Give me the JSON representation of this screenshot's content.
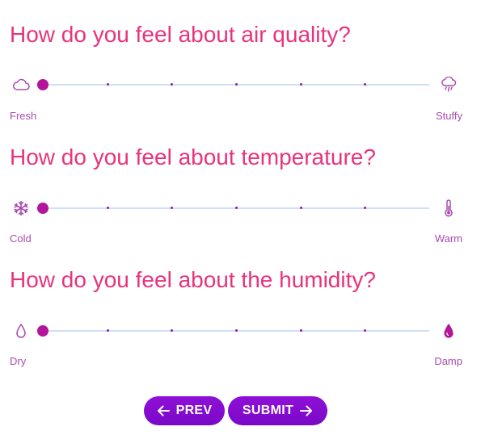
{
  "questions": [
    {
      "title": "How do you feel about air quality?",
      "left_label": "Fresh",
      "right_label": "Stuffy",
      "left_icon": "cloud-icon",
      "right_icon": "cloud-rain-icon",
      "value": 0,
      "steps": 7
    },
    {
      "title": "How do you feel about temperature?",
      "left_label": "Cold",
      "right_label": "Warm",
      "left_icon": "snowflake-icon",
      "right_icon": "thermometer-icon",
      "value": 0,
      "steps": 7
    },
    {
      "title": "How do you feel about the humidity?",
      "left_label": "Dry",
      "right_label": "Damp",
      "left_icon": "water-drop-outline-icon",
      "right_icon": "water-drop-filled-icon",
      "value": 0,
      "steps": 7
    }
  ],
  "buttons": {
    "prev_label": "PREV",
    "submit_label": "SUBMIT",
    "prev_icon": "arrow-left-icon",
    "submit_icon": "arrow-right-icon"
  },
  "colors": {
    "question": "#e8337d",
    "thumb": "#b4169b",
    "track": "#cfe0f5",
    "label": "#a94bae",
    "button": "#8a0fd4"
  }
}
